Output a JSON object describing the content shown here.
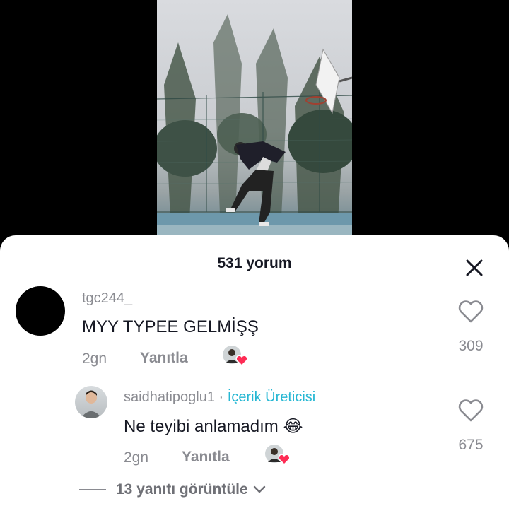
{
  "header": {
    "comment_count": "531 yorum"
  },
  "comments": [
    {
      "username": "tgc244_",
      "text": "MYY TYPEE GELMİŞŞ",
      "age": "2gn",
      "reply_label": "Yanıtla",
      "likes": "309"
    },
    {
      "username": "saidhatipoglu1",
      "separator": " · ",
      "badge": "İçerik Üreticisi",
      "text": "Ne teyibi anlamadım",
      "emoji": "😂",
      "age": "2gn",
      "reply_label": "Yanıtla",
      "likes": "675"
    }
  ],
  "view_replies": {
    "label": "13 yanıtı görüntüle"
  },
  "colors": {
    "accent": "#25b7d3",
    "heart": "#fe2c55",
    "muted": "#8a8b91",
    "text": "#161823"
  },
  "icons": [
    "close-icon",
    "heart-outline-icon",
    "chevron-down-icon",
    "creator-liked-heart-icon"
  ]
}
